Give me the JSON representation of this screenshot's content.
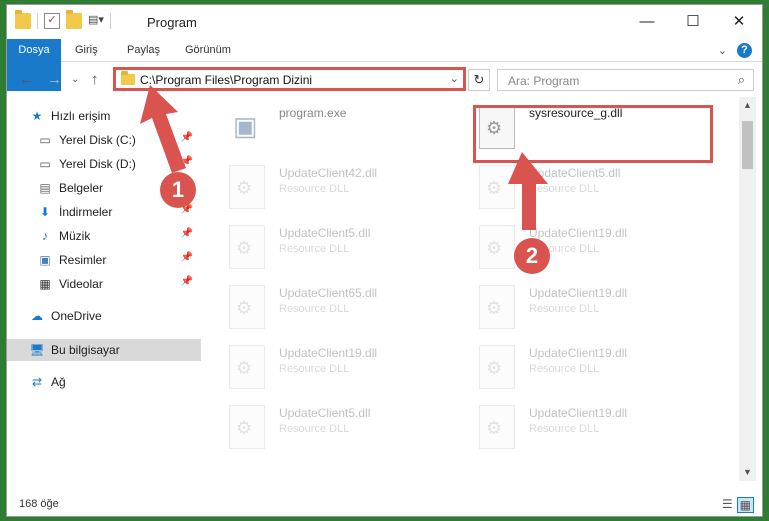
{
  "window": {
    "title": "Program"
  },
  "ribbon": {
    "tabs": [
      "Dosya",
      "Giriş",
      "Paylaş",
      "Görünüm"
    ],
    "help": "?"
  },
  "address": {
    "path": "C:\\Program Files\\Program Dizini"
  },
  "search": {
    "placeholder": "Ara: Program"
  },
  "nav": {
    "items": [
      {
        "label": "Hızlı erişim"
      },
      {
        "label": "Yerel Disk (C:)"
      },
      {
        "label": "Yerel Disk (D:)"
      },
      {
        "label": "Belgeler"
      },
      {
        "label": "İndirmeler"
      },
      {
        "label": "Müzik"
      },
      {
        "label": "Resimler"
      },
      {
        "label": "Videolar"
      },
      {
        "label": "OneDrive"
      },
      {
        "label": "Bu bilgisayar"
      },
      {
        "label": "Ağ"
      }
    ]
  },
  "files": [
    {
      "name": "program.exe",
      "type": ""
    },
    {
      "name": "sysresource_g.dll",
      "type": ""
    },
    {
      "name": "UpdateClient42.dll",
      "type": "Resource DLL"
    },
    {
      "name": "UpdateClient5.dll",
      "type": "Resource DLL"
    },
    {
      "name": "UpdateClient5.dll",
      "type": "Resource DLL"
    },
    {
      "name": "UpdateClient19.dll",
      "type": "Resource DLL"
    },
    {
      "name": "UpdateClient65.dll",
      "type": "Resource DLL"
    },
    {
      "name": "UpdateClient19.dll",
      "type": "Resource DLL"
    },
    {
      "name": "UpdateClient19.dll",
      "type": "Resource DLL"
    },
    {
      "name": "UpdateClient19.dll",
      "type": "Resource DLL"
    },
    {
      "name": "UpdateClient5.dll",
      "type": "Resource DLL"
    },
    {
      "name": "UpdateClient19.dll",
      "type": "Resource DLL"
    }
  ],
  "status": {
    "count": "168 öğe"
  },
  "annotations": {
    "step1": "1",
    "step2": "2"
  },
  "colors": {
    "accent": "#1979ca",
    "highlight": "#d9534f"
  }
}
